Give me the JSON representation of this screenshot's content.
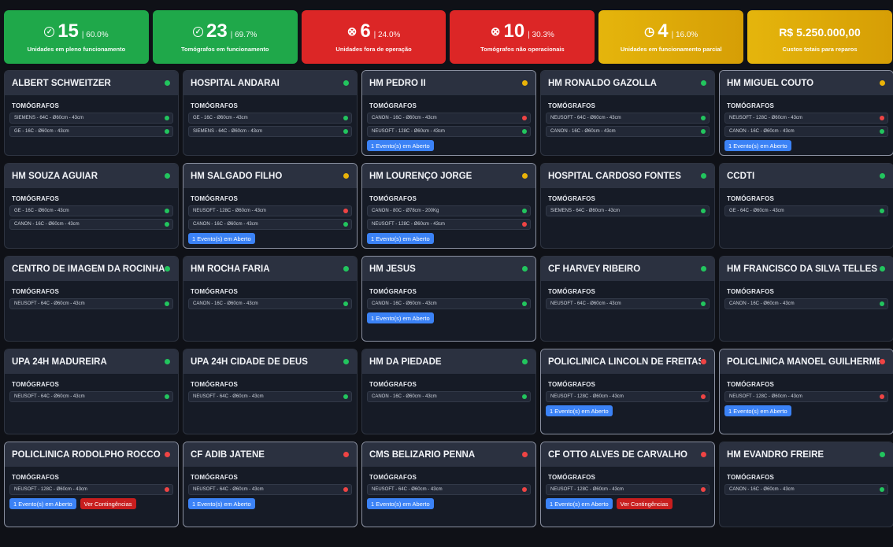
{
  "stats": [
    {
      "icon": "check-circle-icon",
      "value": "15",
      "pct": "| 60.0%",
      "label": "Unidades em pleno funcionamento",
      "color": "green"
    },
    {
      "icon": "check-circle-icon",
      "value": "23",
      "pct": "| 69.7%",
      "label": "Tomógrafos em funcionamento",
      "color": "green"
    },
    {
      "icon": "x-circle-icon",
      "value": "6",
      "pct": "| 24.0%",
      "label": "Unidades fora de operação",
      "color": "red"
    },
    {
      "icon": "x-circle-icon",
      "value": "10",
      "pct": "| 30.3%",
      "label": "Tomógrafos não operacionais",
      "color": "red"
    },
    {
      "icon": "clock-icon",
      "value": "4",
      "pct": "| 16.0%",
      "label": "Unidades em funcionamento parcial",
      "color": "yellow"
    },
    {
      "icon": "",
      "value": "R$ 5.250.000,00",
      "pct": "",
      "label": "Custos totais para reparos",
      "color": "yellow"
    }
  ],
  "section_label": "TOMÓGRAFOS",
  "event_label": "1 Evento(s) em Aberto",
  "contingency_label": "Ver Contingências",
  "status_colors": {
    "green": "#22c55e",
    "yellow": "#eab308",
    "red": "#ef4444"
  },
  "units": [
    {
      "name": "ALBERT SCHWEITZER",
      "status": "green",
      "equipment": [
        {
          "name": "SIEMENS - 64C - Ø60cm - 43cm",
          "status": "green"
        },
        {
          "name": "GE - 16C - Ø60cm - 43cm",
          "status": "green"
        }
      ],
      "event": false,
      "contingency": false
    },
    {
      "name": "HOSPITAL ANDARAÍ",
      "status": "green",
      "equipment": [
        {
          "name": "GE - 16C - Ø60cm - 43cm",
          "status": "green"
        },
        {
          "name": "SIEMENS - 64C - Ø60cm - 43cm",
          "status": "green"
        }
      ],
      "event": false,
      "contingency": false
    },
    {
      "name": "HM PEDRO II",
      "status": "yellow",
      "equipment": [
        {
          "name": "CANON - 16C - Ø60cm - 43cm",
          "status": "red"
        },
        {
          "name": "NEUSOFT - 128C - Ø60cm - 43cm",
          "status": "green"
        }
      ],
      "event": true,
      "contingency": false
    },
    {
      "name": "HM RONALDO GAZOLLA",
      "status": "green",
      "equipment": [
        {
          "name": "NEUSOFT - 64C - Ø60cm - 43cm",
          "status": "green"
        },
        {
          "name": "CANON - 16C - Ø60cm - 43cm",
          "status": "green"
        }
      ],
      "event": false,
      "contingency": false
    },
    {
      "name": "HM MIGUEL COUTO",
      "status": "yellow",
      "equipment": [
        {
          "name": "NEUSOFT - 128C - Ø60cm - 43cm",
          "status": "red"
        },
        {
          "name": "CANON - 16C - Ø60cm - 43cm",
          "status": "green"
        }
      ],
      "event": true,
      "contingency": false
    },
    {
      "name": "HM SOUZA AGUIAR",
      "status": "green",
      "equipment": [
        {
          "name": "GE - 16C - Ø60cm - 43cm",
          "status": "green"
        },
        {
          "name": "CANON - 16C - Ø60cm - 43cm",
          "status": "green"
        }
      ],
      "event": false,
      "contingency": false
    },
    {
      "name": "HM SALGADO FILHO",
      "status": "yellow",
      "equipment": [
        {
          "name": "NEUSOFT - 128C - Ø60cm - 43cm",
          "status": "red"
        },
        {
          "name": "CANON - 16C - Ø60cm - 43cm",
          "status": "green"
        }
      ],
      "event": true,
      "contingency": false
    },
    {
      "name": "HM LOURENÇO JORGE",
      "status": "yellow",
      "equipment": [
        {
          "name": "CANON - 80C - Ø78cm - 200Kg",
          "status": "green"
        },
        {
          "name": "NEUSOFT - 128C - Ø60cm - 43cm",
          "status": "red"
        }
      ],
      "event": true,
      "contingency": false
    },
    {
      "name": "HOSPITAL CARDOSO FONTES",
      "status": "green",
      "equipment": [
        {
          "name": "SIEMENS - 64C - Ø60cm - 43cm",
          "status": "green"
        }
      ],
      "event": false,
      "contingency": false
    },
    {
      "name": "CCDTI",
      "status": "green",
      "equipment": [
        {
          "name": "GE - 64C - Ø60cm - 43cm",
          "status": "green"
        }
      ],
      "event": false,
      "contingency": false
    },
    {
      "name": "CENTRO DE IMAGEM DA ROCINHA",
      "status": "green",
      "equipment": [
        {
          "name": "NEUSOFT - 64C - Ø60cm - 43cm",
          "status": "green"
        }
      ],
      "event": false,
      "contingency": false
    },
    {
      "name": "HM ROCHA FARIA",
      "status": "green",
      "equipment": [
        {
          "name": "CANON - 16C - Ø60cm - 43cm",
          "status": "green"
        }
      ],
      "event": false,
      "contingency": false
    },
    {
      "name": "HM JESUS",
      "status": "green",
      "equipment": [
        {
          "name": "CANON - 16C - Ø60cm - 43cm",
          "status": "green"
        }
      ],
      "event": true,
      "contingency": false
    },
    {
      "name": "CF HARVEY RIBEIRO",
      "status": "green",
      "equipment": [
        {
          "name": "NEUSOFT - 64C - Ø60cm - 43cm",
          "status": "green"
        }
      ],
      "event": false,
      "contingency": false
    },
    {
      "name": "HM FRANCISCO DA SILVA TELLES",
      "status": "green",
      "equipment": [
        {
          "name": "CANON - 16C - Ø60cm - 43cm",
          "status": "green"
        }
      ],
      "event": false,
      "contingency": false
    },
    {
      "name": "UPA 24H MADUREIRA",
      "status": "green",
      "equipment": [
        {
          "name": "NEUSOFT - 64C - Ø60cm - 43cm",
          "status": "green"
        }
      ],
      "event": false,
      "contingency": false
    },
    {
      "name": "UPA 24H CIDADE DE DEUS",
      "status": "green",
      "equipment": [
        {
          "name": "NEUSOFT - 64C - Ø60cm - 43cm",
          "status": "green"
        }
      ],
      "event": false,
      "contingency": false
    },
    {
      "name": "HM DA PIEDADE",
      "status": "green",
      "equipment": [
        {
          "name": "CANON - 16C - Ø60cm - 43cm",
          "status": "green"
        }
      ],
      "event": false,
      "contingency": false
    },
    {
      "name": "POLICLÍNICA LINCOLN DE FREITAS",
      "status": "red",
      "equipment": [
        {
          "name": "NEUSOFT - 128C - Ø60cm - 43cm",
          "status": "red"
        }
      ],
      "event": true,
      "contingency": false
    },
    {
      "name": "POLICLÍNICA MANOEL GUILHERME",
      "status": "red",
      "equipment": [
        {
          "name": "NEUSOFT - 128C - Ø60cm - 43cm",
          "status": "red"
        }
      ],
      "event": true,
      "contingency": false
    },
    {
      "name": "POLICLÍNICA RODOLPHO ROCCO",
      "status": "red",
      "equipment": [
        {
          "name": "NEUSOFT - 128C - Ø60cm - 43cm",
          "status": "red"
        }
      ],
      "event": true,
      "contingency": true
    },
    {
      "name": "CF ADIB JATENE",
      "status": "red",
      "equipment": [
        {
          "name": "NEUSOFT - 64C - Ø60cm - 43cm",
          "status": "red"
        }
      ],
      "event": true,
      "contingency": false
    },
    {
      "name": "CMS BELIZÁRIO PENNA",
      "status": "red",
      "equipment": [
        {
          "name": "NEUSOFT - 64C - Ø60cm - 43cm",
          "status": "red"
        }
      ],
      "event": true,
      "contingency": false
    },
    {
      "name": "CF OTTO ALVES DE CARVALHO",
      "status": "red",
      "equipment": [
        {
          "name": "NEUSOFT - 128C - Ø60cm - 43cm",
          "status": "red"
        }
      ],
      "event": true,
      "contingency": true
    },
    {
      "name": "HM EVANDRO FREIRE",
      "status": "green",
      "equipment": [
        {
          "name": "CANON - 16C - Ø60cm - 43cm",
          "status": "green"
        }
      ],
      "event": false,
      "contingency": false
    }
  ]
}
